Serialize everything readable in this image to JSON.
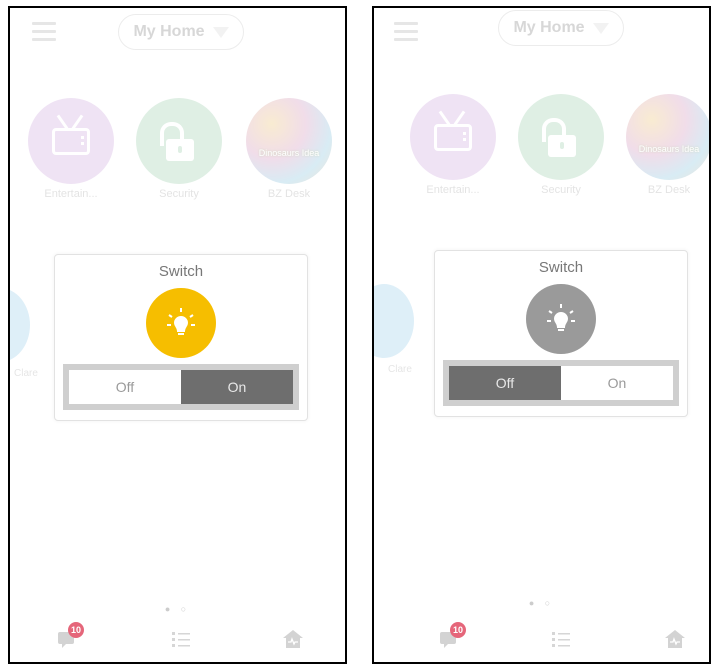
{
  "header": {
    "title": "My Home"
  },
  "tiles": [
    {
      "label": "Entertain...",
      "icon": "tv-icon"
    },
    {
      "label": "Security",
      "icon": "unlocked-padlock-icon"
    },
    {
      "label": "BZ Desk",
      "icon": "photo-thumbnail",
      "photo_text": "Dinosaurs Idea"
    },
    {
      "label": "Clare",
      "icon": "partial-tile"
    }
  ],
  "screens": [
    {
      "dialog_title": "Switch",
      "off_label": "Off",
      "on_label": "On",
      "state": "on",
      "bulb_color": "#f6be00"
    },
    {
      "dialog_title": "Switch",
      "off_label": "Off",
      "on_label": "On",
      "state": "off",
      "bulb_color": "#9a9a9a"
    }
  ],
  "pager": {
    "dots": "● ○",
    "current_page": 1,
    "total_pages": 2
  },
  "bottom_nav": [
    {
      "icon": "messages-icon",
      "badge": "10"
    },
    {
      "icon": "list-icon"
    },
    {
      "icon": "home-activity-icon"
    }
  ],
  "colors": {
    "entertainment": "#dcc0e7",
    "security": "#b8dcc4",
    "bulb_on": "#f6be00",
    "bulb_off": "#9a9a9a",
    "segment_active": "#6e6e6e",
    "badge": "#e5667a"
  }
}
